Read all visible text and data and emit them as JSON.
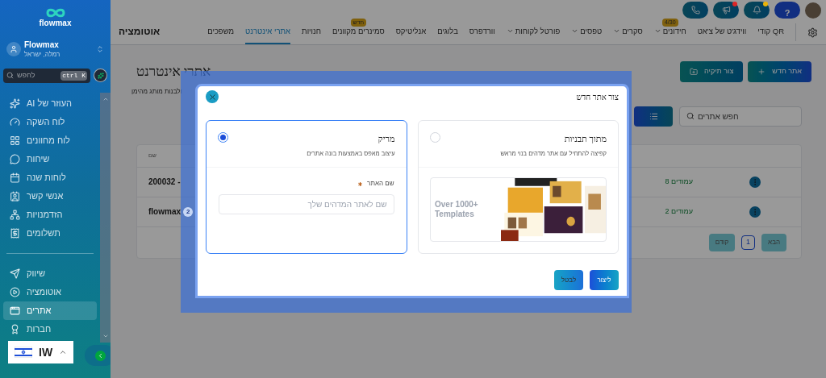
{
  "sidebar": {
    "logo": "flowmax",
    "account": {
      "name": "Flowmax",
      "location": "רמלה, ישראל"
    },
    "search": {
      "placeholder": "לחפש",
      "shortcut": "ctrl K"
    },
    "items": [
      {
        "label": "העוזר של AI",
        "selected": false
      },
      {
        "label": "לוח השקה",
        "selected": false
      },
      {
        "label": "לוח מחוונים",
        "selected": false
      },
      {
        "label": "שיחות",
        "selected": false
      },
      {
        "label": "לוחות שנה",
        "selected": false
      },
      {
        "label": "אנשי קשר",
        "selected": false
      },
      {
        "label": "הזדמנויות",
        "selected": false
      },
      {
        "label": "תשלומים",
        "selected": false
      }
    ],
    "items_2": [
      {
        "label": "שיווק",
        "selected": false
      },
      {
        "label": "אוטומציה",
        "selected": false
      },
      {
        "label": "אתרים",
        "selected": true
      },
      {
        "label": "חברות",
        "selected": false
      }
    ],
    "language": {
      "code": "IW"
    }
  },
  "top_buttons": [
    {
      "kind": "phone"
    },
    {
      "kind": "megaphone",
      "color": "#dc2626"
    },
    {
      "kind": "bell",
      "color": "#eab308"
    },
    {
      "kind": "help",
      "label": "?"
    }
  ],
  "nav": {
    "title": "אוטומציה",
    "items": [
      {
        "label": "QR קודי",
        "selected": false,
        "dropdown": false
      },
      {
        "label": "ווידג'ט של צ'אט",
        "selected": false,
        "dropdown": false
      },
      {
        "label": "חידונים",
        "selected": false,
        "dropdown": true,
        "badge": "4/30"
      },
      {
        "label": "סקרים",
        "selected": false,
        "dropdown": true
      },
      {
        "label": "טפסים",
        "selected": false,
        "dropdown": true
      },
      {
        "label": "פורטל לקוחות",
        "selected": false,
        "dropdown": true
      },
      {
        "label": "וורדפרס",
        "selected": false,
        "dropdown": false
      },
      {
        "label": "בלוגים",
        "selected": false,
        "dropdown": false
      },
      {
        "label": "אנליטיקס",
        "selected": false,
        "dropdown": false
      },
      {
        "label": "סמינרים מקוונים",
        "selected": false,
        "dropdown": false,
        "badge": "חדש"
      },
      {
        "label": "חנויות",
        "selected": false,
        "dropdown": false
      },
      {
        "label": "אתרי אינטרנט",
        "selected": true,
        "dropdown": false
      },
      {
        "label": "משפכים",
        "selected": false,
        "dropdown": false
      }
    ]
  },
  "page": {
    "title": "אתרי אינטרנט",
    "subtitle": "ולבנות מותג מהימן",
    "new_button": "אתר חדש",
    "folder_button": "צור תיקיה",
    "search": {
      "placeholder": "חפש אתרים"
    },
    "table": {
      "columns": [
        "שם"
      ],
      "rows": [
        {
          "name": "200032 -",
          "pages": "עמודים 8"
        },
        {
          "name": "flowmax",
          "badge": "2",
          "pages": "עמודים 2"
        }
      ]
    },
    "pagination": {
      "previous": "קודם",
      "page": "1",
      "next": "הבא"
    }
  },
  "dialog": {
    "title": "צור אתר חדש",
    "options": [
      {
        "title": "מתוך תבניות",
        "description": "קפיצה להתחיל עם אתר מדהים בנוי מראש",
        "selected": false,
        "kind": "templates",
        "banner": "Over 1000+ Templates"
      },
      {
        "title": "מריק",
        "description": "עיצוב מאפס באמצעות בונה אתרים",
        "selected": true,
        "kind": "blank",
        "field": {
          "label": "שם האתר",
          "required": true,
          "placeholder": "שם לאתר המדהים שלך"
        }
      }
    ],
    "buttons": [
      {
        "label": "ליצור",
        "kind": "primary"
      },
      {
        "label": "לבטל",
        "kind": "secondary"
      }
    ]
  }
}
